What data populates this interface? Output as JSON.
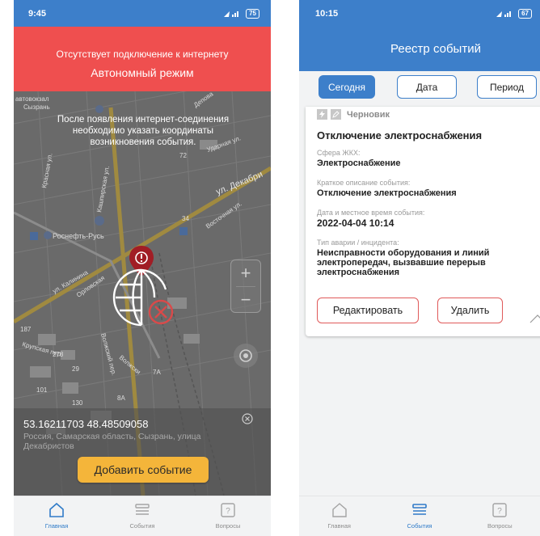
{
  "screen1": {
    "status_time": "9:45",
    "battery": "75",
    "banner_line1": "Отсутствует подключение к интернету",
    "banner_line2": "Автономный режим",
    "map_note": "После появления интернет-соединения необходимо указать координаты возникновения события.",
    "map_labels": {
      "station": "автовокзал",
      "station2": "Сызрань",
      "depot": "Депова",
      "street_dekabr": "ул. Декабри",
      "udarnaya": "Ударная ул.",
      "krasnaya": "Красная ул.",
      "kalinina": "ул. Калинина",
      "kashpir": "Кашпирская ул.",
      "rosneft": "Роснефть-Русь",
      "vostochnaya": "Восточная ул.",
      "oryol": "Орловская",
      "volzhsky": "Волжский пер.",
      "volzhsk2": "Волжски",
      "krupsk": "Крупская пер.",
      "numbers": [
        "187",
        "278",
        "29",
        "101",
        "130",
        "7А",
        "8А",
        "72",
        "34"
      ]
    },
    "zoom_in": "+",
    "zoom_out": "−",
    "coordinates": "53.16211703 48.48509058",
    "address": "Россия, Самарская область, Сызрань, улица Декабристов",
    "add_button": "Добавить событие",
    "tabs": [
      {
        "label": "Главная",
        "active": true
      },
      {
        "label": "События",
        "active": false
      },
      {
        "label": "Вопросы",
        "active": false
      }
    ]
  },
  "screen2": {
    "status_time": "10:15",
    "battery": "67",
    "title": "Реестр событий",
    "filters": [
      {
        "label": "Сегодня",
        "active": true
      },
      {
        "label": "Дата",
        "active": false
      },
      {
        "label": "Период",
        "active": false
      }
    ],
    "card": {
      "status": "Черновик",
      "title": "Отключение электроснабжения",
      "sphere_label": "Сфера ЖКХ:",
      "sphere_value": "Электроснабжение",
      "desc_label": "Краткое описание события:",
      "desc_value": "Отключение электроснабжения",
      "date_label": "Дата и местное время события:",
      "date_value": "2022-04-04 10:14",
      "type_label": "Тип аварии / инцидента:",
      "type_value": "Неисправности оборудования и линий электропередач, вызвавшие перерыв электроснабжения",
      "edit_button": "Редактировать",
      "delete_button": "Удалить"
    },
    "tabs": [
      {
        "label": "Главная",
        "active": false
      },
      {
        "label": "События",
        "active": true
      },
      {
        "label": "Вопросы",
        "active": false
      }
    ]
  },
  "colors": {
    "primary": "#3d7fca",
    "banner": "#ef4f4f",
    "accent_button": "#f4b53a",
    "danger_border": "#e05a5a"
  }
}
